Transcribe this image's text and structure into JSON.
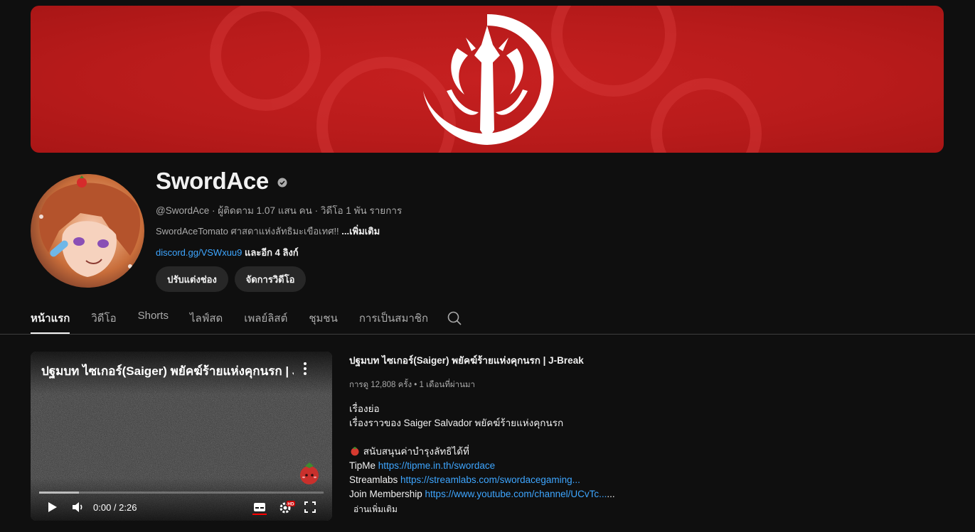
{
  "channel": {
    "name": "SwordAce",
    "meta": "@SwordAce · ผู้ติดตาม 1.07 แสน คน · วิดีโอ 1 พัน รายการ",
    "description": "SwordAceTomato ศาสดาแห่งลัทธิมะเขือเทศ!! ",
    "more_label": "...เพิ่มเติม",
    "link_text": "discord.gg/VSWxuu9",
    "more_links": " และอีก 4 ลิงก์",
    "customize_button": "ปรับแต่งช่อง",
    "manage_button": "จัดการวิดีโอ",
    "verified_icon": "verified-check-icon",
    "accent_color": "#c41e1e"
  },
  "tabs": [
    {
      "label": "หน้าแรก",
      "active": true
    },
    {
      "label": "วิดีโอ",
      "active": false
    },
    {
      "label": "Shorts",
      "active": false
    },
    {
      "label": "ไลฟ์สด",
      "active": false
    },
    {
      "label": "เพลย์ลิสต์",
      "active": false
    },
    {
      "label": "ชุมชน",
      "active": false
    },
    {
      "label": "การเป็นสมาชิก",
      "active": false
    }
  ],
  "player": {
    "title": "ปฐมบท ไซเกอร์(Saiger) พยัคฆ์ร้ายแห่งคุกนรก | J-Break",
    "time": "0:00 / 2:26",
    "quality_badge": "HD",
    "progress_buffered": 0.14
  },
  "featured": {
    "title": "ปฐมบท ไซเกอร์(Saiger) พยัคฆ์ร้ายแห่งคุกนรก | J-Break",
    "views": "การดู 12,808 ครั้ง • 1 เดือนที่ผ่านมา",
    "desc_heading": "เรื่องย่อ",
    "desc_story": "เรื่องราวของ Saiger Salvador พยัคฆ์ร้ายแห่งคุกนรก",
    "support_line": " สนับสนุนค่าบำรุงลัทธิได้ที่",
    "tipme_label": "TipMe ",
    "tipme_url": "https://tipme.in.th/swordace",
    "streamlabs_label": "Streamlabs ",
    "streamlabs_url": "https://streamlabs.com/swordacegaming...",
    "membership_label": "Join Membership ",
    "membership_url": "https://www.youtube.com/channel/UCvTc...",
    "membership_tail": "...",
    "read_more": "อ่านเพิ่มเติม"
  }
}
